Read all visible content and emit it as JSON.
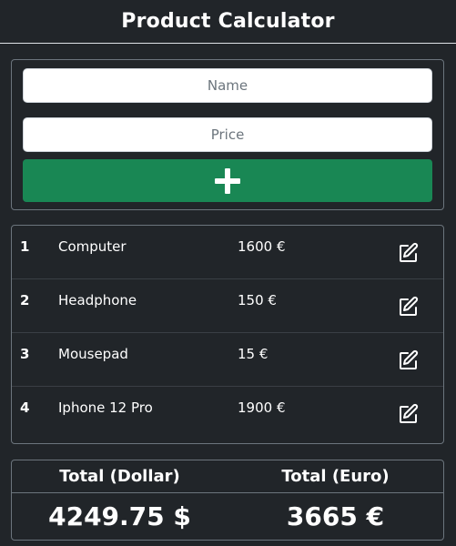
{
  "header": {
    "title": "Product Calculator"
  },
  "form": {
    "name_placeholder": "Name",
    "name_value": "",
    "price_placeholder": "Price",
    "price_value": "",
    "add_icon": "plus-icon",
    "add_button_color": "#198754"
  },
  "products": [
    {
      "index": "1",
      "name": "Computer",
      "price": "1600 €",
      "action_icon": "edit-icon"
    },
    {
      "index": "2",
      "name": "Headphone",
      "price": "150 €",
      "action_icon": "edit-icon"
    },
    {
      "index": "3",
      "name": "Mousepad",
      "price": "15 €",
      "action_icon": "edit-icon"
    },
    {
      "index": "4",
      "name": "Iphone 12 Pro",
      "price": "1900 €",
      "action_icon": "edit-icon"
    }
  ],
  "totals": {
    "dollar_label": "Total (Dollar)",
    "euro_label": "Total (Euro)",
    "dollar_value": "4249.75 $",
    "euro_value": "3665 €"
  },
  "colors": {
    "background": "#212529",
    "border": "#6c757d",
    "text": "#ffffff",
    "accent": "#198754"
  }
}
